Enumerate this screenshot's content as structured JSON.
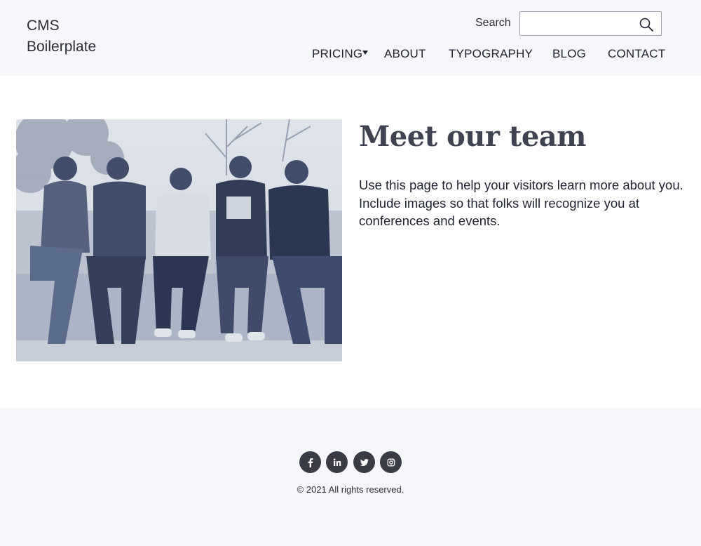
{
  "site": {
    "logo_line1": "CMS",
    "logo_line2": "Boilerplate"
  },
  "search": {
    "label": "Search",
    "value": "",
    "placeholder": ""
  },
  "nav": {
    "items": [
      {
        "label": "PRICING"
      },
      {
        "label": "ABOUT"
      },
      {
        "label": "TYPOGRAPHY"
      },
      {
        "label": "BLOG"
      },
      {
        "label": "CONTACT"
      }
    ]
  },
  "main": {
    "headline": "Meet our team",
    "intro": "Use this page to help your visitors learn more about you. Include images so that folks will recognize you at conferences and events."
  },
  "footer": {
    "social": [
      "facebook-icon",
      "linkedin-icon",
      "twitter-icon",
      "instagram-icon"
    ],
    "copyright": "© 2021 All rights reserved."
  },
  "colors": {
    "header_bg": "#f6f7fa",
    "footer_bg": "#f6f7fa",
    "text": "#1f2330",
    "headline": "#3f4250",
    "social_bg": "#3a3c45",
    "photo_tint": "#5c6b8a"
  }
}
